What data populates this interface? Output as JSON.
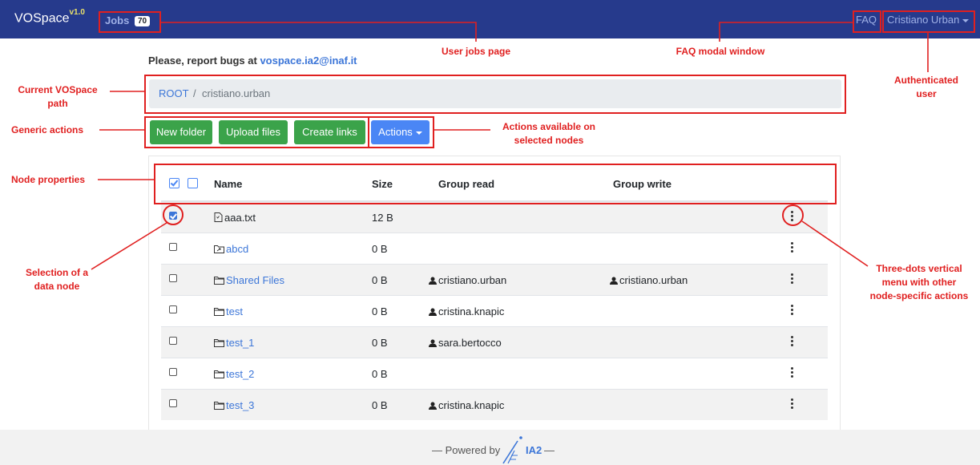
{
  "navbar": {
    "brand": "VOSpace",
    "version": "v1.0",
    "jobs_label": "Jobs",
    "jobs_count": "70",
    "faq_label": "FAQ",
    "user_label": "Cristiano Urban"
  },
  "report": {
    "text": "Please, report bugs at",
    "email": "vospace.ia2@inaf.it"
  },
  "breadcrumb": {
    "root": "ROOT",
    "separator": "/",
    "current": "cristiano.urban"
  },
  "actions": {
    "new_folder": "New folder",
    "upload_files": "Upload files",
    "create_links": "Create links",
    "actions_menu": "Actions"
  },
  "table": {
    "headers": [
      "Name",
      "Size",
      "Group read",
      "Group write"
    ],
    "rows": [
      {
        "checked": true,
        "icon": "file-icon",
        "name": "aaa.txt",
        "is_link": false,
        "size": "12 B",
        "group_read": "",
        "group_write": ""
      },
      {
        "checked": false,
        "icon": "link-folder-icon",
        "name": "abcd",
        "is_link": true,
        "size": "0 B",
        "group_read": "",
        "group_write": ""
      },
      {
        "checked": false,
        "icon": "folder-icon",
        "name": "Shared Files",
        "is_link": true,
        "size": "0 B",
        "group_read": "cristiano.urban",
        "group_write": "cristiano.urban"
      },
      {
        "checked": false,
        "icon": "folder-icon",
        "name": "test",
        "is_link": true,
        "size": "0 B",
        "group_read": "cristina.knapic",
        "group_write": ""
      },
      {
        "checked": false,
        "icon": "folder-icon",
        "name": "test_1",
        "is_link": true,
        "size": "0 B",
        "group_read": "sara.bertocco",
        "group_write": ""
      },
      {
        "checked": false,
        "icon": "folder-icon",
        "name": "test_2",
        "is_link": true,
        "size": "0 B",
        "group_read": "",
        "group_write": ""
      },
      {
        "checked": false,
        "icon": "folder-icon",
        "name": "test_3",
        "is_link": true,
        "size": "0 B",
        "group_read": "cristina.knapic",
        "group_write": ""
      }
    ]
  },
  "footer": {
    "prefix": "— Powered by",
    "brand": "IA2",
    "suffix": "—"
  },
  "annotations": {
    "user_jobs": "User jobs page",
    "faq_modal": "FAQ modal window",
    "auth_user_1": "Authenticated",
    "auth_user_2": "user",
    "current_path_1": "Current VOSpace",
    "current_path_2": "path",
    "generic_actions": "Generic actions",
    "actions_selected_1": "Actions available on",
    "actions_selected_2": "selected nodes",
    "node_properties": "Node properties",
    "selection_1": "Selection of a",
    "selection_2": "data node",
    "three_dots_1": "Three-dots vertical",
    "three_dots_2": "menu with  other",
    "three_dots_3": "node-specific actions"
  },
  "colors": {
    "navbar": "#263a8c",
    "primary_link": "#3c76d8",
    "green_button": "#3ba34a",
    "blue_button": "#4a86f5",
    "annotation_red": "#e02020"
  }
}
